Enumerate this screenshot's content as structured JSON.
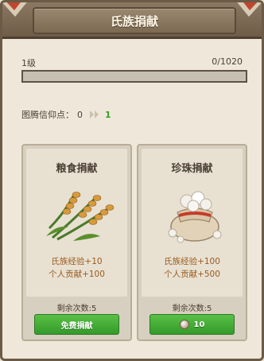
{
  "header": {
    "title": "氏族捐献"
  },
  "level": {
    "label": "1级",
    "exp_text": "0/1020",
    "exp_progress": 0
  },
  "points": {
    "label": "图腾信仰点：",
    "current": "0",
    "next": "1"
  },
  "cards": [
    {
      "title": "粮食捐献",
      "icon": "grain-icon",
      "gain_clan": "氏族经验+10",
      "gain_personal": "个人贡献+100",
      "remaining": "剩余次数:5",
      "button_label": "免费捐献"
    },
    {
      "title": "珍珠捐献",
      "icon": "pearl-sack-icon",
      "gain_clan": "氏族经验+100",
      "gain_personal": "个人贡献+500",
      "remaining": "剩余次数:5",
      "button_label": "10",
      "button_icon": "pearl-icon"
    }
  ],
  "colors": {
    "accent_green": "#3b9a2a",
    "gain_text": "#9a5a1e",
    "title_bar": "#7d6a53"
  }
}
